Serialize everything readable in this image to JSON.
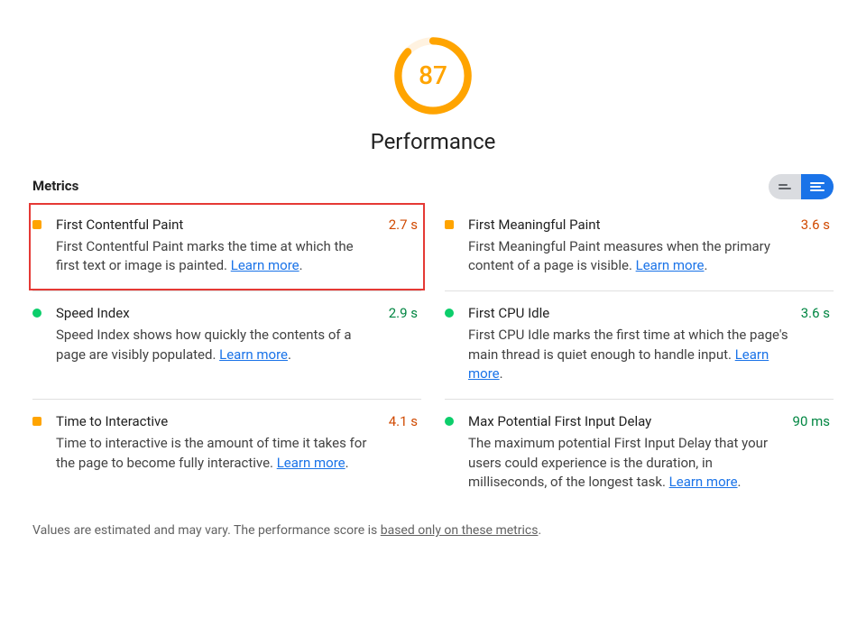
{
  "gauge": {
    "score": "87",
    "label": "Performance",
    "percent": 0.87
  },
  "section": {
    "title": "Metrics"
  },
  "learn_more_label": "Learn more",
  "metrics": [
    {
      "name": "First Contentful Paint",
      "value": "2.7 s",
      "status": "avg",
      "highlight": true,
      "desc_pre": "First Contentful Paint marks the time at which the first text or image is painted. ",
      "desc_post": "."
    },
    {
      "name": "First Meaningful Paint",
      "value": "3.6 s",
      "status": "avg",
      "highlight": false,
      "desc_pre": "First Meaningful Paint measures when the primary content of a page is visible. ",
      "desc_post": "."
    },
    {
      "name": "Speed Index",
      "value": "2.9 s",
      "status": "pass",
      "highlight": false,
      "desc_pre": "Speed Index shows how quickly the contents of a page are visibly populated. ",
      "desc_post": "."
    },
    {
      "name": "First CPU Idle",
      "value": "3.6 s",
      "status": "pass",
      "highlight": false,
      "desc_pre": "First CPU Idle marks the first time at which the page's main thread is quiet enough to handle input. ",
      "desc_post": "."
    },
    {
      "name": "Time to Interactive",
      "value": "4.1 s",
      "status": "avg",
      "highlight": false,
      "desc_pre": "Time to interactive is the amount of time it takes for the page to become fully interactive. ",
      "desc_post": "."
    },
    {
      "name": "Max Potential First Input Delay",
      "value": "90 ms",
      "status": "pass",
      "highlight": false,
      "desc_pre": "The maximum potential First Input Delay that your users could experience is the duration, in milliseconds, of the longest task. ",
      "desc_post": "."
    }
  ],
  "footer": {
    "pre": "Values are estimated and may vary. The performance score is ",
    "link": "based only on these metrics",
    "post": "."
  },
  "chart_data": {
    "type": "table",
    "title": "Performance Metrics",
    "series": [
      {
        "name": "First Contentful Paint",
        "value": 2.7,
        "unit": "s",
        "status": "average"
      },
      {
        "name": "First Meaningful Paint",
        "value": 3.6,
        "unit": "s",
        "status": "average"
      },
      {
        "name": "Speed Index",
        "value": 2.9,
        "unit": "s",
        "status": "pass"
      },
      {
        "name": "First CPU Idle",
        "value": 3.6,
        "unit": "s",
        "status": "pass"
      },
      {
        "name": "Time to Interactive",
        "value": 4.1,
        "unit": "s",
        "status": "average"
      },
      {
        "name": "Max Potential First Input Delay",
        "value": 90,
        "unit": "ms",
        "status": "pass"
      }
    ],
    "gauge": {
      "score": 87,
      "max": 100
    }
  }
}
